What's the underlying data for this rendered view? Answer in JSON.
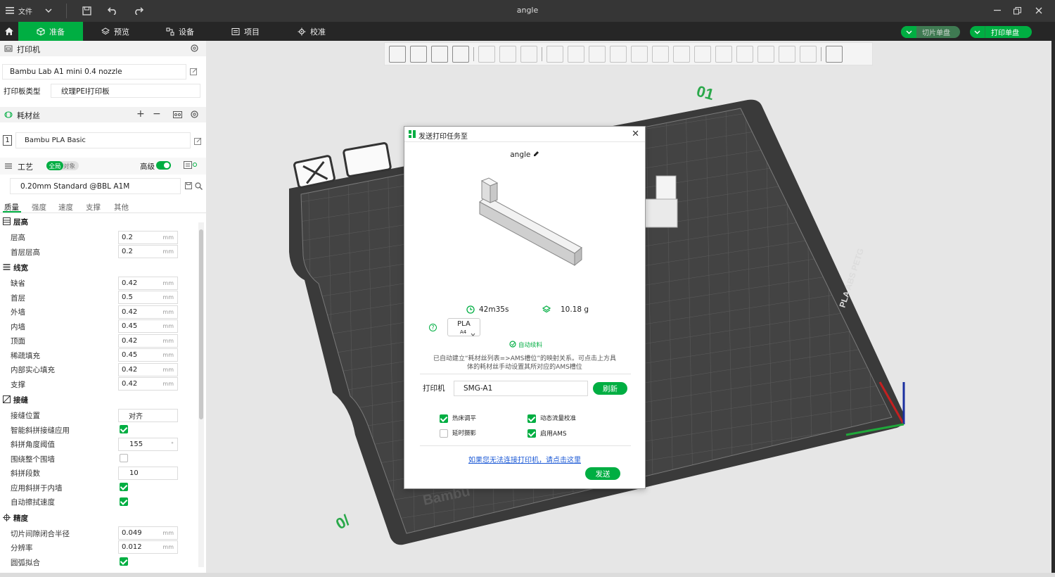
{
  "titlebar": {
    "file_menu": "文件",
    "window_title": "angle",
    "icons": [
      "menu-icon",
      "chevron-down-icon",
      "save-icon",
      "undo-icon",
      "redo-icon",
      "minimize-icon",
      "restore-icon",
      "close-icon"
    ]
  },
  "navbar": {
    "tabs": [
      {
        "label": "准备",
        "icon": "cube-outline-icon",
        "active": true
      },
      {
        "label": "预览",
        "icon": "layers-icon",
        "active": false
      },
      {
        "label": "设备",
        "icon": "device-icon",
        "active": false
      },
      {
        "label": "项目",
        "icon": "project-icon",
        "active": false
      },
      {
        "label": "校准",
        "icon": "calibrate-icon",
        "active": false
      }
    ],
    "slice_label": "切片单盘",
    "print_label": "打印单盘",
    "accent": "#00ae42"
  },
  "printer_section": {
    "title": "打印机",
    "printer_name": "Bambu Lab A1 mini 0.4 nozzle",
    "plate_label": "打印板类型",
    "plate_value": "纹理PEI打印板"
  },
  "filament_section": {
    "title": "耗材丝",
    "slot": "1",
    "filament": "Bambu PLA Basic"
  },
  "process_section": {
    "title": "工艺",
    "toggle_global": "全局",
    "toggle_object": "对象",
    "advanced_label": "高级",
    "profile": "0.20mm Standard @BBL A1M",
    "tabs": [
      "质量",
      "强度",
      "速度",
      "支撑",
      "其他"
    ],
    "active_tab": "质量"
  },
  "settings": {
    "unit": "mm",
    "layer_height_group": "层高",
    "layer_height_label": "层高",
    "layer_height": "0.2",
    "first_layer_height_label": "首层层高",
    "first_layer_height": "0.2",
    "line_width_group": "线宽",
    "lw_default_label": "缺省",
    "lw_default": "0.42",
    "lw_first_label": "首层",
    "lw_first": "0.5",
    "lw_outer_label": "外墙",
    "lw_outer": "0.42",
    "lw_inner_label": "内墙",
    "lw_inner": "0.45",
    "lw_top_label": "顶面",
    "lw_top": "0.42",
    "lw_sparse_label": "稀疏填充",
    "lw_sparse": "0.45",
    "lw_solid_label": "内部实心填充",
    "lw_solid": "0.42",
    "lw_support_label": "支撑",
    "lw_support": "0.42",
    "seam_group": "接缝",
    "seam_pos_label": "接缝位置",
    "seam_pos": "对齐",
    "smart_scarf_label": "智能斜拼接缝应用",
    "smart_scarf": true,
    "scarf_angle_label": "斜拼角度阈值",
    "scarf_angle": "155",
    "scarf_unit": "°",
    "around_wall_label": "围绕整个围墙",
    "around_wall": false,
    "scarf_steps_label": "斜拼段数",
    "scarf_steps": "10",
    "scarf_inner_label": "应用斜拼于内墙",
    "scarf_inner": true,
    "auto_wipe_label": "自动擦拭速度",
    "auto_wipe": true,
    "precision_group": "精度",
    "gap_close_label": "切片间隙闭合半径",
    "gap_close": "0.049",
    "resolution_label": "分辨率",
    "resolution": "0.012",
    "arc_fit_label": "圆弧拟合",
    "arc_fit": true
  },
  "modal": {
    "title": "发送打印任务至",
    "job_name": "angle",
    "time": "42m35s",
    "weight": "10.18 g",
    "filament_type": "PLA",
    "filament_slot": "A4",
    "auto_refill": "自动续料",
    "mapping_note_1": "已自动建立“耗材丝列表=>AMS槽位”的映射关系。可点击上方具",
    "mapping_note_2": "体的耗材丝手动设置其所对应的AMS槽位",
    "printer_label": "打印机",
    "printer_value": "SMG-A1",
    "refresh_label": "刷新",
    "options": [
      {
        "label": "热床调平",
        "checked": true
      },
      {
        "label": "动态流量校准",
        "checked": true
      },
      {
        "label": "延时摄影",
        "checked": false
      },
      {
        "label": "启用AMS",
        "checked": true
      }
    ],
    "cant_connect_link": "如果您无法连接打印机，请点击这里",
    "send_label": "发送",
    "help_icon": "?"
  },
  "plate": {
    "brand": "Bambu",
    "surface_text": "PLA ABS PETG",
    "corner_text": "0/",
    "top_text": "01"
  }
}
